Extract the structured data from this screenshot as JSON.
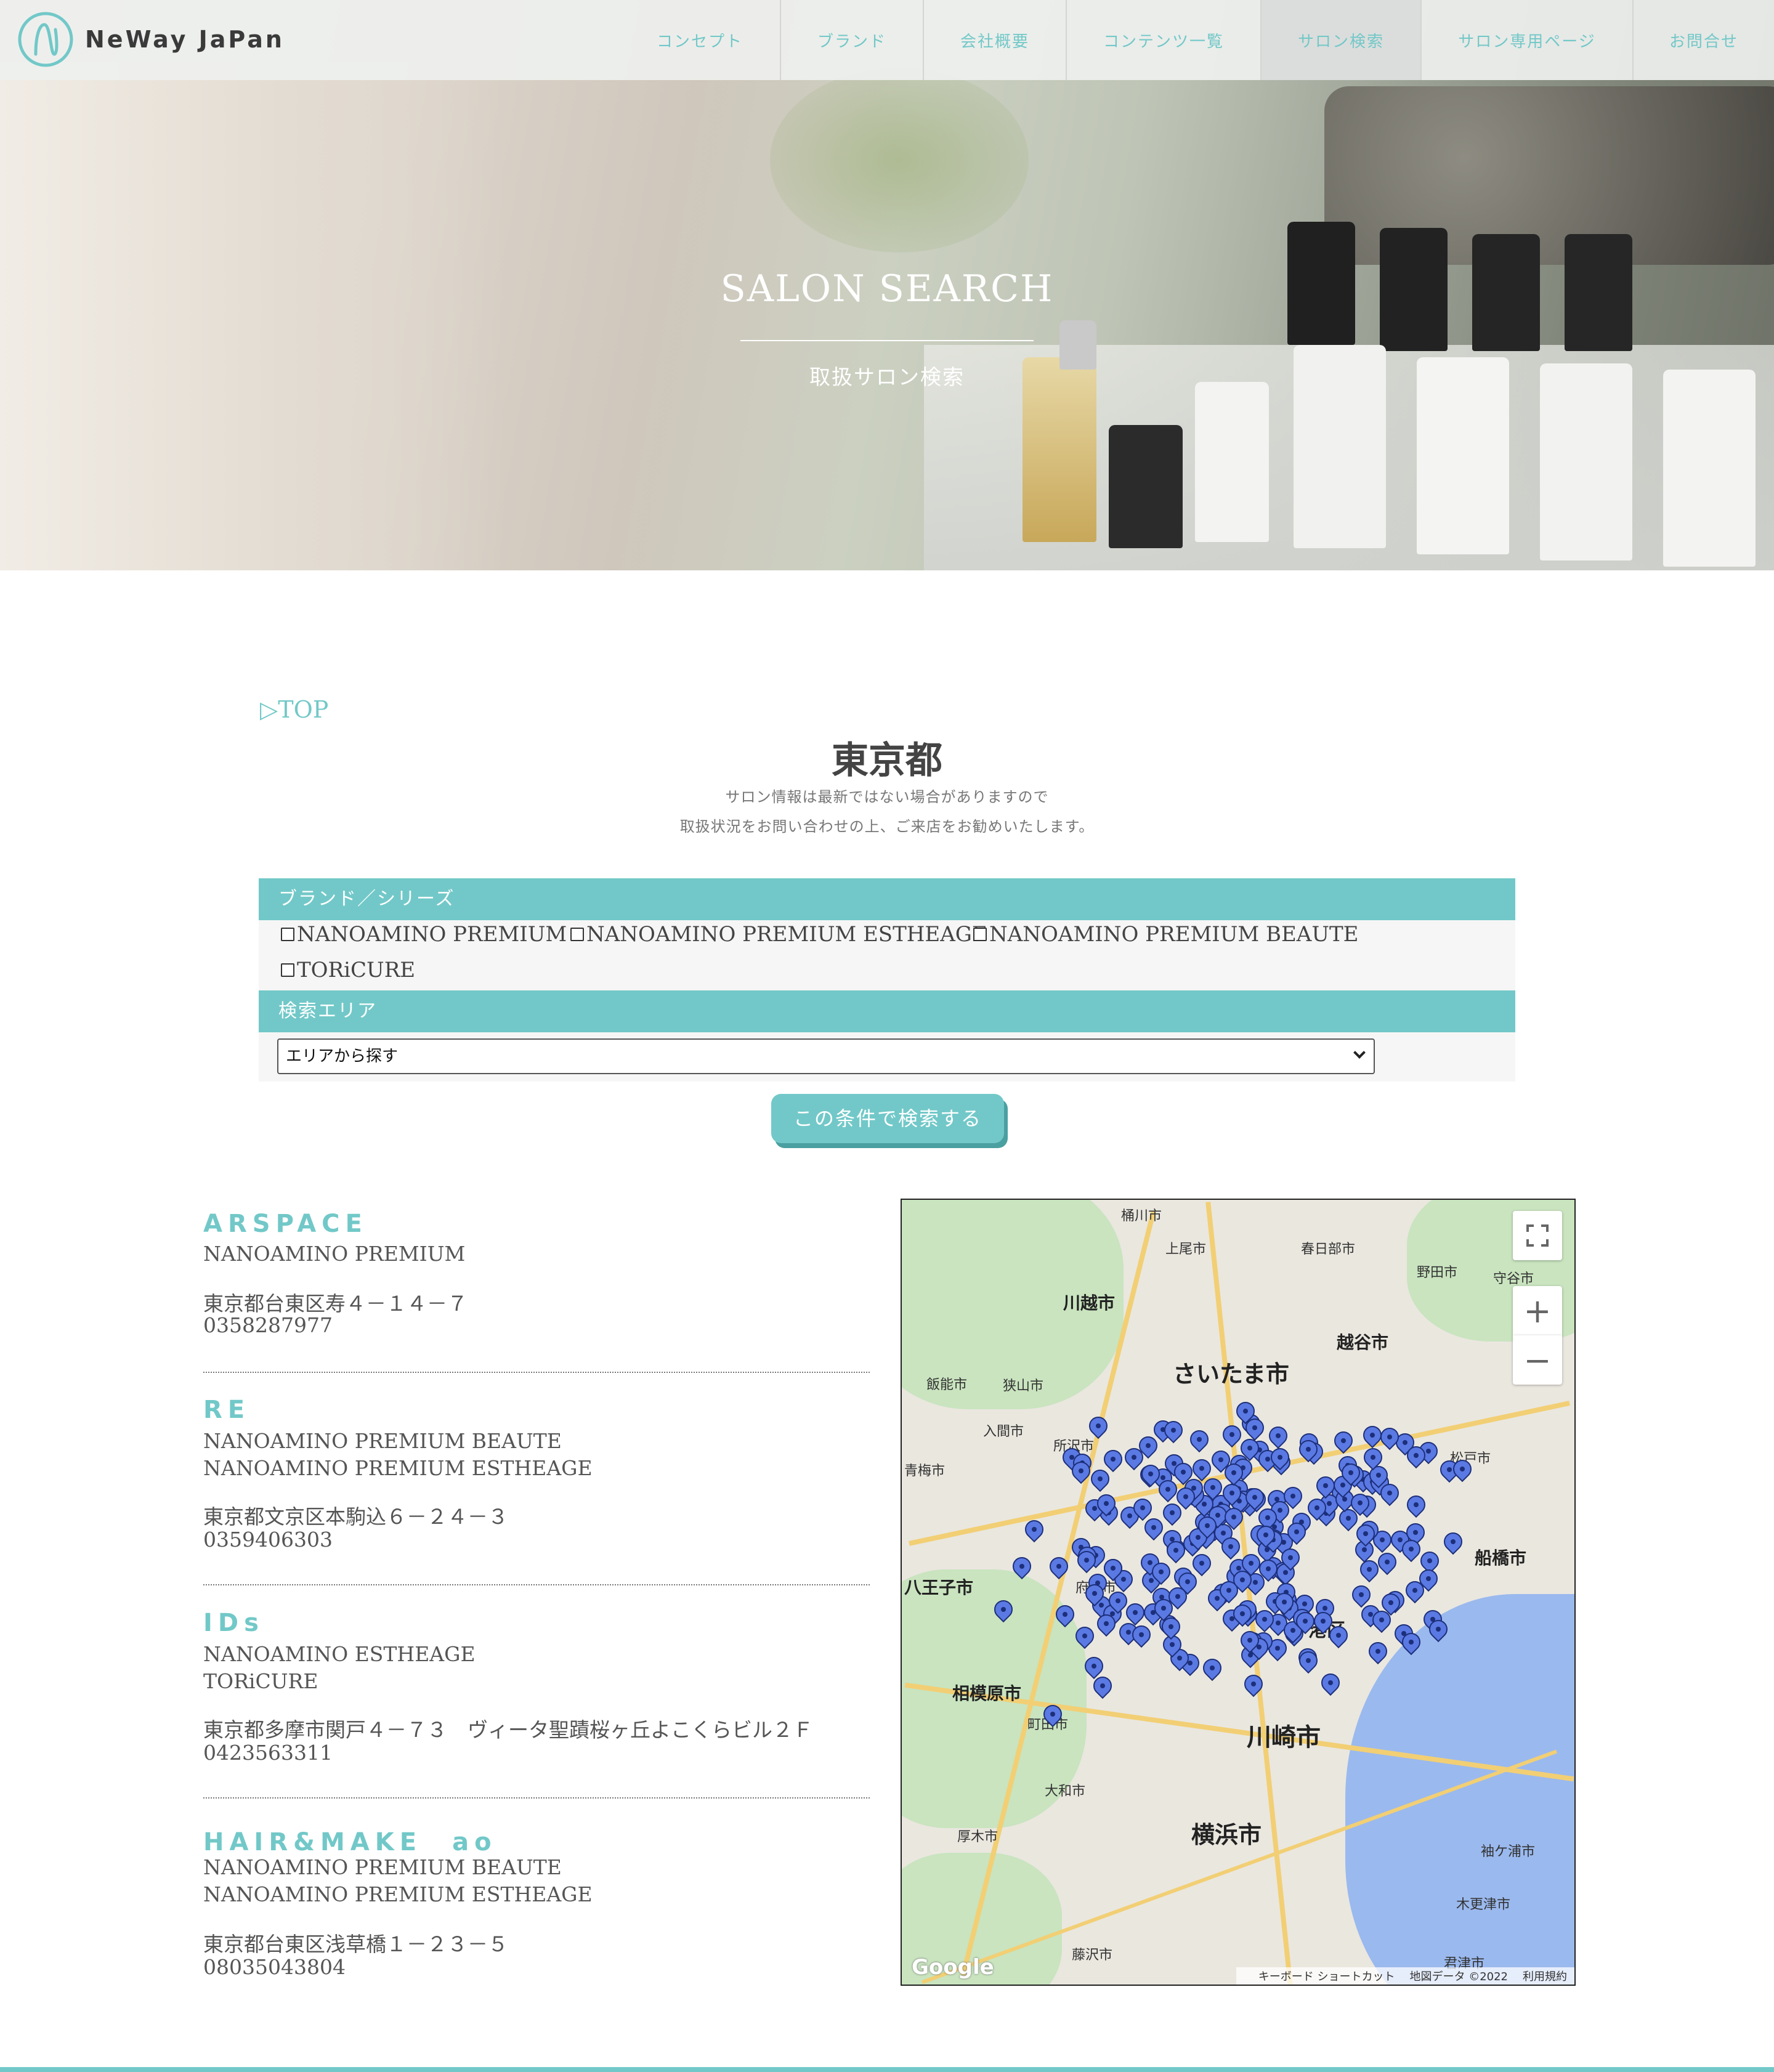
{
  "header": {
    "logo_text": "NeWay JaPan",
    "nav": [
      "コンセプト",
      "ブランド",
      "会社概要",
      "コンテンツ一覧",
      "サロン検索",
      "サロン専用ページ",
      "お問合せ"
    ]
  },
  "hero": {
    "title": "SALON SEARCH",
    "subtitle": "取扱サロン検索"
  },
  "main": {
    "top_link": "▷TOP",
    "title": "東京都",
    "notice_1": "サロン情報は最新ではない場合がありますので",
    "notice_2": "取扱状況をお問い合わせの上、ご来店をお勧めいたします。"
  },
  "form": {
    "brand_header": "ブランド／シリーズ",
    "brands": [
      "NANOAMINO PREMIUM",
      "NANOAMINO PREMIUM ESTHEAGE",
      "NANOAMINO PREMIUM BEAUTE",
      "TORiCURE"
    ],
    "area_header": "検索エリア",
    "area_select": "エリアから探す",
    "search_button": "この条件で検索する"
  },
  "salons": [
    {
      "name": "ARSPACE",
      "brands": [
        "NANOAMINO PREMIUM"
      ],
      "address": "東京都台東区寿４－１４－７",
      "phone": "0358287977"
    },
    {
      "name": "RE",
      "brands": [
        "NANOAMINO PREMIUM BEAUTE",
        "NANOAMINO PREMIUM ESTHEAGE"
      ],
      "address": "東京都文京区本駒込６－２４－３",
      "phone": "0359406303"
    },
    {
      "name": "IDs",
      "brands": [
        "NANOAMINO ESTHEAGE",
        "TORiCURE"
      ],
      "address": "東京都多摩市関戸４－７３　ヴィータ聖蹟桜ヶ丘よこくらビル２Ｆ",
      "phone": "0423563311"
    },
    {
      "name": "HAIR&MAKE　ao",
      "brands": [
        "NANOAMINO PREMIUM BEAUTE",
        "NANOAMINO PREMIUM ESTHEAGE"
      ],
      "address": "東京都台東区浅草橋１－２３－５",
      "phone": "08035043804"
    }
  ],
  "map": {
    "cities": [
      "川越市",
      "さいたま市",
      "越谷市",
      "川崎市",
      "横浜市",
      "港区",
      "八王子市",
      "相模原市",
      "船橋市"
    ],
    "towns": [
      "桶川市",
      "上尾市",
      "春日部市",
      "野田市",
      "守谷市",
      "飯能市",
      "狭山市",
      "入間市",
      "所沢市",
      "青梅市",
      "松戸市",
      "府中市",
      "町田市",
      "大和市",
      "厚木市",
      "藤沢市",
      "木更津市",
      "袖ケ浦市",
      "君津市"
    ],
    "zoom_in": "+",
    "zoom_out": "−",
    "footer": [
      "キーボード ショートカット",
      "地図データ ©2022",
      "利用規約"
    ],
    "google": "Google",
    "icons": [
      "fullscreen-icon",
      "map-pin-icon"
    ],
    "pin_color": "#5a79e3"
  },
  "colors": {
    "accent": "#72c8c8",
    "text": "#555555"
  }
}
